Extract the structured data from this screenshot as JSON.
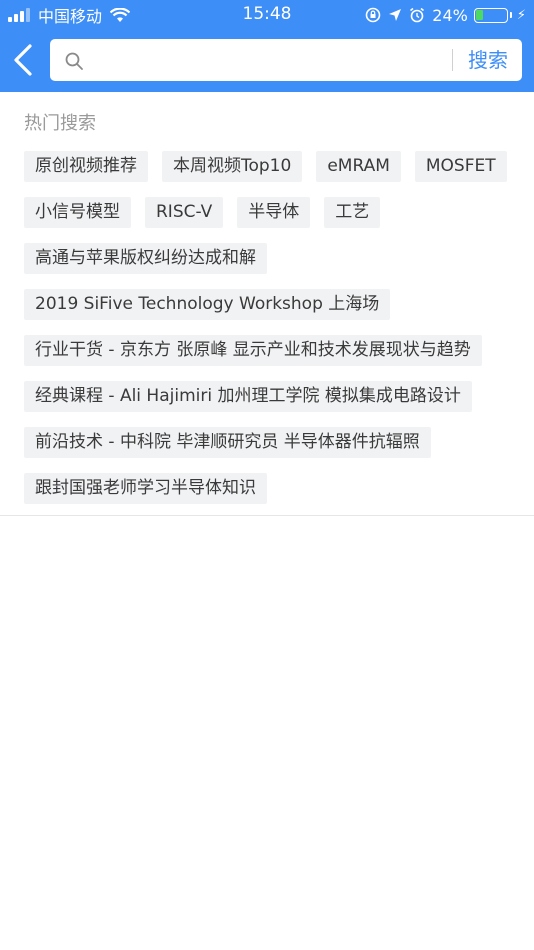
{
  "status_bar": {
    "carrier": "中国移动",
    "time": "15:48",
    "battery_percent": "24%",
    "battery_level": 0.24,
    "icons": [
      "signal-icon",
      "wifi-icon",
      "rotation-lock-icon",
      "location-icon",
      "alarm-icon",
      "battery-icon",
      "charging-icon"
    ]
  },
  "nav": {
    "back_icon": "chevron-left-icon",
    "search_placeholder": "",
    "search_value": "",
    "search_button_label": "搜索"
  },
  "hot_search": {
    "title": "热门搜索",
    "tags": [
      "原创视频推荐",
      "本周视频Top10",
      "eMRAM",
      "MOSFET",
      "小信号模型",
      "RISC-V",
      "半导体",
      "工艺",
      "高通与苹果版权纠纷达成和解",
      "2019 SiFive Technology Workshop 上海场",
      "行业干货 - 京东方 张原峰 显示产业和技术发展现状与趋势",
      "经典课程 - Ali Hajimiri 加州理工学院 模拟集成电路设计",
      "前沿技术 - 中科院 毕津顺研究员 半导体器件抗辐照",
      "跟封国强老师学习半导体知识"
    ]
  },
  "colors": {
    "accent": "#3e8ef7",
    "tag_background": "#f1f2f4",
    "tag_text": "#3a3a3a",
    "section_title": "#9a9a9a"
  }
}
